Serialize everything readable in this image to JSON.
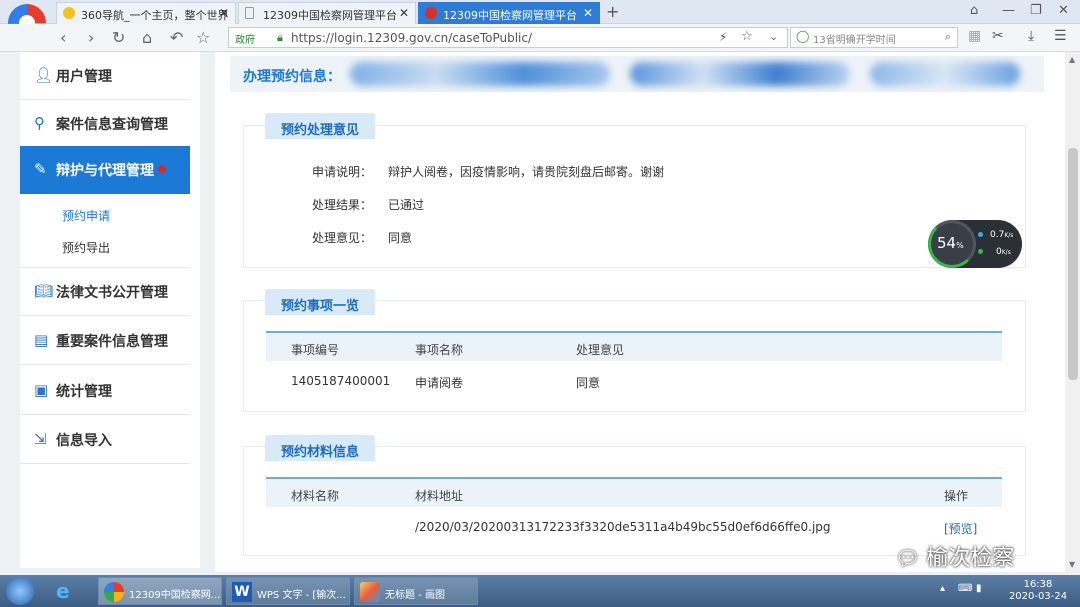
{
  "browser": {
    "tabs": [
      {
        "label": "360导航_一个主页，整个世界",
        "active": false
      },
      {
        "label": "12309中国检察网管理平台",
        "active": false
      },
      {
        "label": "12309中国检察网管理平台",
        "active": true
      }
    ],
    "new_tab": "+",
    "url_gov_badge": "政府",
    "url": "https://login.12309.gov.cn/caseToPublic/",
    "search_placeholder": "13省明确开学时间"
  },
  "sidebar": {
    "items": [
      {
        "label": "用户管理",
        "icon": "user-icon"
      },
      {
        "label": "案件信息查询管理",
        "icon": "case-search-icon"
      },
      {
        "label": "辩护与代理管理",
        "icon": "defense-icon",
        "active": true
      },
      {
        "label": "法律文书公开管理",
        "icon": "book-icon"
      },
      {
        "label": "重要案件信息管理",
        "icon": "important-case-icon"
      },
      {
        "label": "统计管理",
        "icon": "statistics-icon"
      },
      {
        "label": "信息导入",
        "icon": "import-icon"
      }
    ],
    "subitems": [
      {
        "label": "预约申请",
        "active": true
      },
      {
        "label": "预约导出",
        "active": false
      }
    ]
  },
  "main": {
    "info_label": "办理预约信息：",
    "section1": {
      "title": "预约处理意见",
      "rows": [
        {
          "key": "申请说明：",
          "value": "辩护人阅卷，因疫情影响，请贵院刻盘后邮寄。谢谢"
        },
        {
          "key": "处理结果：",
          "value": "已通过"
        },
        {
          "key": "处理意见：",
          "value": "同意"
        }
      ]
    },
    "section2": {
      "title": "预约事项一览",
      "headers": [
        "事项编号",
        "事项名称",
        "处理意见"
      ],
      "rows": [
        [
          "1405187400001",
          "申请阅卷",
          "同意"
        ]
      ]
    },
    "section3": {
      "title": "预约材料信息",
      "headers": [
        "材料名称",
        "材料地址",
        "操作"
      ],
      "rows": [
        [
          "",
          "/2020/03/20200313172233f3320de5311a4b49bc55d0ef6d66ffe0.jpg",
          "[预览]"
        ]
      ]
    }
  },
  "speed_widget": {
    "percent": "54",
    "percent_unit": "%",
    "up": "0.7",
    "down": "0",
    "unit": "K/s"
  },
  "taskbar": {
    "tasks": [
      "12309中国检察网...",
      "WPS 文字 - [输次...",
      "无标题 - 画图"
    ],
    "time": "16:38",
    "date": "2020-03-24"
  },
  "watermark": "榆次检察",
  "colors": {
    "accent": "#1c7ad6",
    "card_title_bg": "#d8e9f8",
    "table_line": "#6aaee0"
  }
}
